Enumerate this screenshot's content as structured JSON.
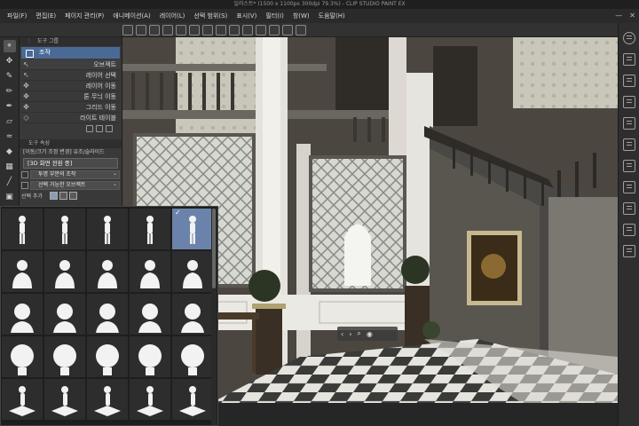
{
  "window": {
    "title": "일러스트* (1500 x 1100px 300dpi 79.3%) - CLIP STUDIO PAINT EX",
    "min_icon": "minimize-icon",
    "close_icon": "close-icon"
  },
  "menu": [
    {
      "label": "파일(F)"
    },
    {
      "label": "편집(E)"
    },
    {
      "label": "페이지 관리(P)"
    },
    {
      "label": "애니메이션(A)"
    },
    {
      "label": "레이어(L)"
    },
    {
      "label": "선택 범위(S)"
    },
    {
      "label": "표시(V)"
    },
    {
      "label": "필터(I)"
    },
    {
      "label": "창(W)"
    },
    {
      "label": "도움말(H)"
    }
  ],
  "sub_tool": {
    "group_label": "도구 그룹",
    "selected": "조작",
    "items": [
      {
        "label": "오브젝트",
        "icon": "cursor-icon"
      },
      {
        "label": "레이어 선택",
        "icon": "layer-select-icon"
      },
      {
        "label": "레이어 이동",
        "icon": "move-icon"
      },
      {
        "label": "톤 무늬 이동",
        "icon": "move-icon"
      },
      {
        "label": "그리드 이동",
        "icon": "move-icon"
      },
      {
        "label": "라이트 테이블 ",
        "icon": "light-table-icon"
      }
    ]
  },
  "tool_property": {
    "head": "도구 속성",
    "line1": "[이동/크기 조정 변경] 유조/슬라이드",
    "model_label": "[3D 화면 전환 중]",
    "rows": [
      {
        "label": "",
        "value": "투명 부분의 조작"
      },
      {
        "label": "",
        "value": "선택 가능한 오브젝트"
      }
    ],
    "add_label": "선택 추가"
  },
  "canvas": {
    "description_hidden": true
  },
  "pose_grid": {
    "rows": 5,
    "cols": 5,
    "selected_index": 4,
    "check_mark": "✓"
  },
  "colors": {
    "accent": "#4a6a96",
    "selected_pose": "#6b83ab",
    "panel": "#393939",
    "bg": "#2b2b2b"
  }
}
